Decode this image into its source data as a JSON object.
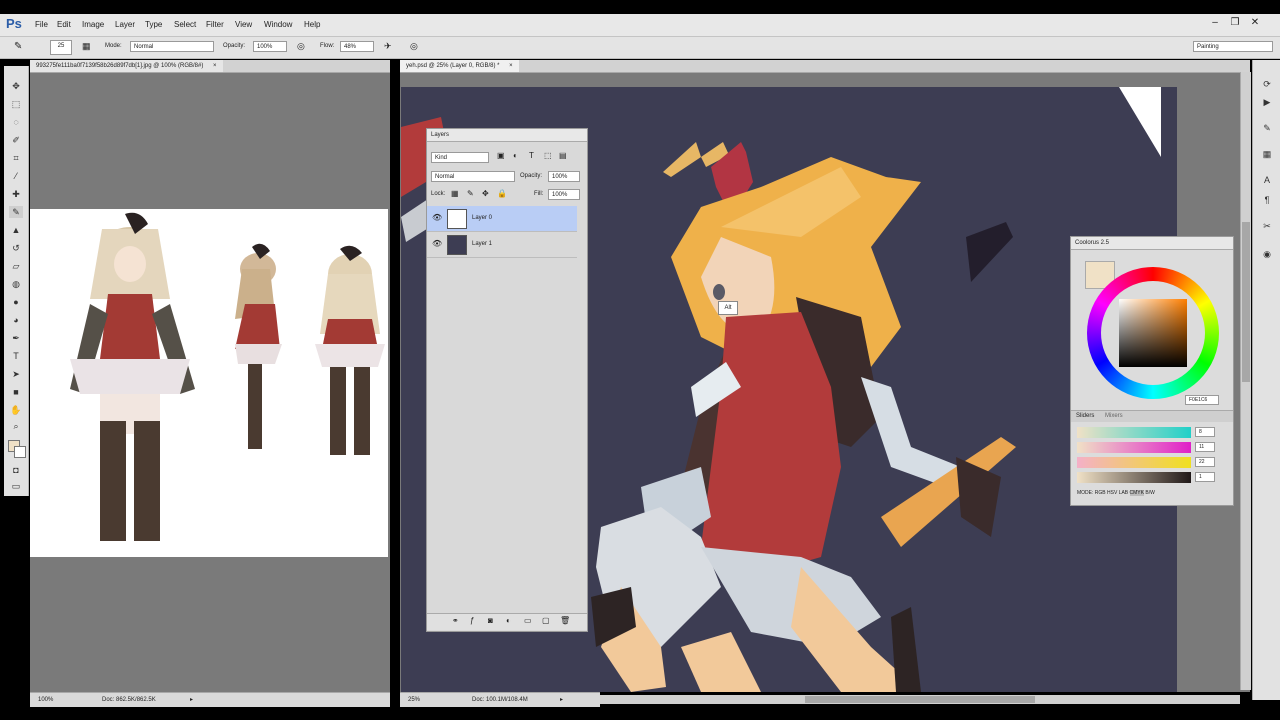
{
  "app": {
    "logo": "Ps"
  },
  "menu": [
    "File",
    "Edit",
    "Image",
    "Layer",
    "Type",
    "Select",
    "Filter",
    "View",
    "Window",
    "Help"
  ],
  "window_controls": {
    "minimize": "–",
    "restore": "❐",
    "close": "✕"
  },
  "options": {
    "brush_size": "25",
    "mode_label": "Mode:",
    "mode_value": "Normal",
    "opacity_label": "Opacity:",
    "opacity_value": "100%",
    "flow_label": "Flow:",
    "flow_value": "48%",
    "workspace": "Painting"
  },
  "tabs": {
    "left": "993275fe111ba0f7139f58b26d89f7db[1].jpg @ 100% (RGB/8#)",
    "right": "yeh.psd @ 25% (Layer 0, RGB/8) *",
    "close": "×"
  },
  "status": {
    "left_zoom": "100%",
    "left_doc": "Doc: 862.5K/862.5K",
    "right_zoom": "25%",
    "right_doc": "Doc: 100.1M/108.4M"
  },
  "layers_panel": {
    "title": "Layers",
    "kind": "Kind",
    "blend": "Normal",
    "opacity_label": "Opacity:",
    "opacity_value": "100%",
    "lock_label": "Lock:",
    "fill_label": "Fill:",
    "fill_value": "100%",
    "layers": [
      {
        "name": "Layer 0"
      },
      {
        "name": "Layer 1"
      }
    ]
  },
  "coolorus": {
    "title": "Coolorus 2.5",
    "hex": "F0E1C6",
    "tabs": [
      "Sliders",
      "Mixers"
    ],
    "slider_values": [
      "8",
      "11",
      "22",
      "1"
    ],
    "mode_label": "MODE:",
    "modes": [
      "RGB",
      "HSV",
      "LAB",
      "CMYK",
      "B/W"
    ],
    "active_mode": "CMYK"
  },
  "tooltip": {
    "alt": "Alt"
  },
  "colors": {
    "canvas_bg": "#3d3d53",
    "workspace_bg": "#7a7a7a",
    "foreground": "#f0e1c6"
  }
}
